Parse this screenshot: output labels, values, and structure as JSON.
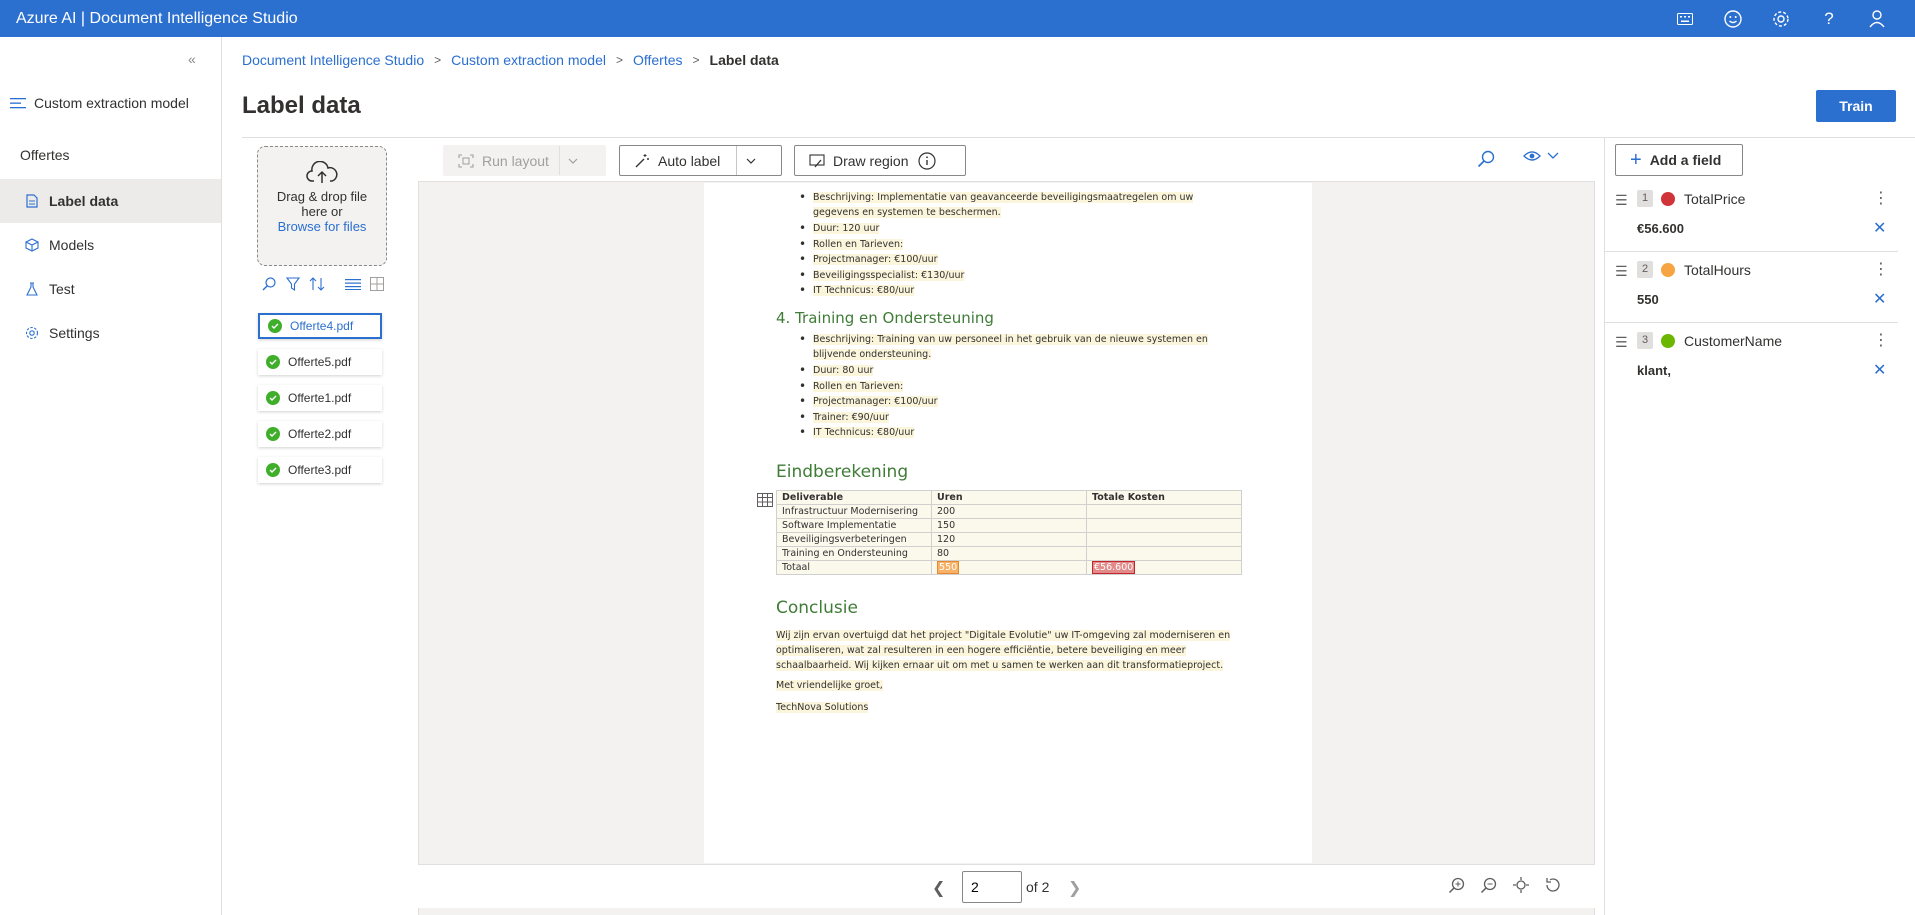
{
  "app": {
    "title": "Azure AI | Document Intelligence Studio",
    "header_icons": [
      "keyboard-icon",
      "feedback-smiley-icon",
      "settings-gear-icon",
      "help-icon",
      "account-icon"
    ]
  },
  "nav": {
    "header": "Custom extraction model",
    "project": "Offertes",
    "items": [
      {
        "label": "Label data",
        "icon": "document-icon",
        "active": true
      },
      {
        "label": "Models",
        "icon": "cube-icon",
        "active": false
      },
      {
        "label": "Test",
        "icon": "flask-icon",
        "active": false
      },
      {
        "label": "Settings",
        "icon": "gear-icon",
        "active": false
      }
    ]
  },
  "breadcrumb": [
    "Document Intelligence Studio",
    "Custom extraction model",
    "Offertes",
    "Label data"
  ],
  "page_title": "Label data",
  "train_label": "Train",
  "dropzone": {
    "line1": "Drag & drop file",
    "line2": "here or",
    "link": "Browse for files"
  },
  "files": [
    "Offerte4.pdf",
    "Offerte5.pdf",
    "Offerte1.pdf",
    "Offerte2.pdf",
    "Offerte3.pdf"
  ],
  "toolbar": {
    "run_layout": "Run layout",
    "auto_label": "Auto label",
    "draw_region": "Draw region"
  },
  "document": {
    "bullets_top": [
      "Beschrijving: Implementatie van geavanceerde beveiligingsmaatregelen om uw",
      "gegevens en systemen te beschermen.",
      "Duur: 120 uur",
      "Rollen en Tarieven:",
      "Projectmanager: €100/uur",
      "Beveiligingsspecialist: €130/uur",
      "IT Technicus: €80/uur"
    ],
    "section4": "4. Training en Ondersteuning",
    "bullets_s4": [
      "Beschrijving: Training van uw personeel in het gebruik van de nieuwe systemen en",
      "blijvende ondersteuning.",
      "Duur: 80 uur",
      "Rollen en Tarieven:",
      "Projectmanager: €100/uur",
      "Trainer: €90/uur",
      "IT Technicus: €80/uur"
    ],
    "calc_heading": "Eindberekening",
    "table": {
      "headers": [
        "Deliverable",
        "Uren",
        "Totale Kosten"
      ],
      "rows": [
        [
          "Infrastructuur Modernisering",
          "200",
          ""
        ],
        [
          "Software Implementatie",
          "150",
          ""
        ],
        [
          "Beveiligingsverbeteringen",
          "120",
          ""
        ],
        [
          "Training en Ondersteuning",
          "80",
          ""
        ],
        [
          "Totaal",
          "550",
          "€56.600"
        ]
      ]
    },
    "conclusion_heading": "Conclusie",
    "conclusion_lines": [
      "Wij zijn ervan overtuigd dat het project \"Digitale Evolutie\" uw IT-omgeving zal moderniseren en",
      "optimaliseren, wat zal resulteren in een hogere efficiëntie, betere beveiliging en meer",
      "schaalbaarheid. Wij kijken ernaar uit om met u samen te werken aan dit transformatieproject."
    ],
    "closing": "Met vriendelijke groet,",
    "company": "TechNova Solutions"
  },
  "pagenav": {
    "current": "2",
    "of": "of 2"
  },
  "fields_panel": {
    "add_label": "Add a field",
    "fields": [
      {
        "num": "1",
        "name": "TotalPrice",
        "value": "€56.600",
        "color": "#d13438"
      },
      {
        "num": "2",
        "name": "TotalHours",
        "value": "550",
        "color": "#f7a543"
      },
      {
        "num": "3",
        "name": "CustomerName",
        "value": "klant,",
        "color": "#6bb700"
      }
    ]
  }
}
